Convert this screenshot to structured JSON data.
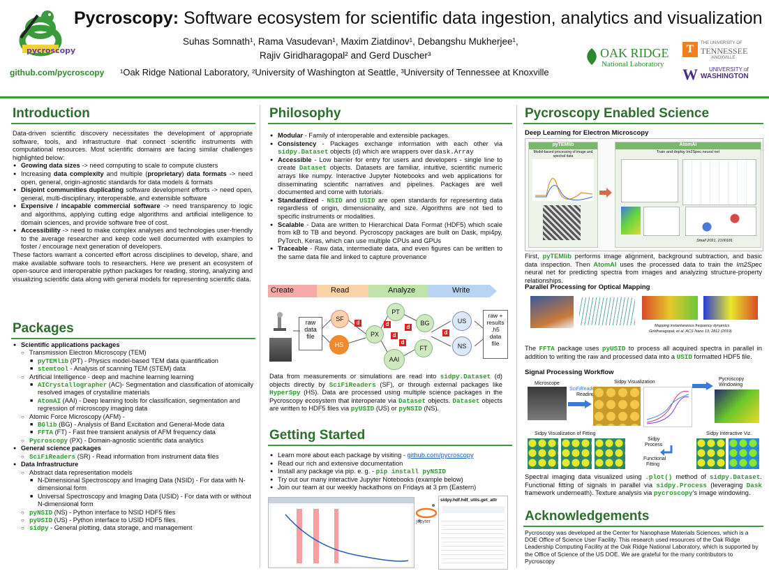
{
  "header": {
    "title_bold": "Pycroscopy:",
    "title_rest": " Software ecosystem for scientific data ingestion, analytics and visualization",
    "authors_line1": "Suhas Somnath¹, Rama Vasudevan¹, Maxim Ziatdinov¹, Debangshu Mukherjee¹,",
    "authors_line2": "Rajiv Giridharagopal² and Gerd Duscher³",
    "affiliations": "¹Oak Ridge National Laboratory, ²University of Washington at Seattle, ³University of Tennessee at Knoxville",
    "logo_text": "pycroscopy",
    "github": "github.com/pycroscopy",
    "ornl_line1": "OAK RIDGE",
    "ornl_line2": "National Laboratory",
    "utk_line1": "THE UNIVERSITY OF",
    "utk_line2": "TENNESSEE",
    "utk_line3": "KNOXVILLE",
    "uw_line1": "UNIVERSITY of",
    "uw_line2": "WASHINGTON",
    "colors": {
      "green": "#2c6e2c",
      "orange": "#f07f1e",
      "purple": "#4b2e83"
    }
  },
  "intro": {
    "title": "Introduction",
    "para1": "Data-driven scientific discovery necessitates the development of appropriate software, tools, and infrastructure that connect scientific instruments with computational resources. Most scientific domains are facing similar challenges highlighted below:",
    "bullets": [
      {
        "b": "Growing data sizes",
        "t": " -> need computing to scale to compute clusters"
      },
      {
        "b": "",
        "t": "Increasing data complexity and multiple (proprietary) data formats -> need open, general, origin-agnostic standards for data models & formats"
      },
      {
        "b": "Disjoint communities duplicating",
        "t": " software development efforts -> need open, general, multi-disciplinary, interoperable, and extensible software"
      },
      {
        "b": "Expensive / incapable commercial software",
        "t": " -> need transparency to logic and algorithms, applying cutting edge algorithms and artificial intelligence to domain sciences, and provide software free of cost."
      },
      {
        "b": "Accessibility",
        "t": " -> need to make complex analyses and technologies user-friendly to the average researcher and keep code well documented with examples to foster / encourage next generation of developers."
      }
    ],
    "para2": "These factors warrant a concerted effort across disciplines to develop, share, and make available software tools to researchers. Here we present an ecosystem of open-source and interoperable python packages for reading, storing, analyzing and visualizing scientific data along with general models for representing scientific data."
  },
  "packages": {
    "title": "Packages",
    "sci_apps": "Scientific applications packages",
    "tem": "Transmission Electron Microscopy (TEM)",
    "pytemlib": "pyTEMlib",
    "pytemlib_desc": " (PT) - Physics model-based TEM data quantification",
    "stemtool": "stemtool",
    "stemtool_desc": " - Analysis of scanning TEM (STEM) data",
    "ai": "Artificial Intelligence - deep and machine learning learning",
    "aicryst": "AICrystallographer",
    "aicryst_desc": " (AC)- Segmentation and classification of atomically resolved images of crystalline materials",
    "atomai": "AtomAI",
    "atomai_desc": " (AAI) - Deep learning tools for classification, segmentation and regression of microscopy imaging data",
    "afm": "Atomic Force Microscopy (AFM) -",
    "bglib": "BGlib",
    "bglib_desc": " (BG) - Analysis of Band Excitation and General-Mode data",
    "ffta": "FFTA",
    "ffta_desc": " (FT) - Fast free transient analysis of AFM frequency data",
    "pycro": "Pycroscopy",
    "pycro_desc": " (PX) - Domain-agnostic scientific data analytics",
    "gen_sci": "General science packages",
    "scifi": "SciFiReaders",
    "scifi_desc": " (SR) - Read information from instrument data files",
    "infra": "Data Infrastructure",
    "abstract": "Abstract data representation models",
    "nsid": "N-Dimensional Spectroscopy and Imaging Data (NSID) - For data with N-dimensional form",
    "usid": "Universal Spectroscopy and Imaging Data (USID) - For data with or without N-dimensional form",
    "pynsid": "pyNSID",
    "pynsid_desc": " (NS) - Python interface to NSID HDF5 files",
    "pyusid": "pyUSID",
    "pyusid_desc": " (US) - Python interface to USID HDF5 files",
    "sidpy": "sidpy",
    "sidpy_desc": " - General plotting, data storage, and management"
  },
  "philosophy": {
    "title": "Philosophy",
    "items": [
      {
        "b": "Modular",
        "t": " - Family of interoperable and extensible packages."
      },
      {
        "b": "Consistency",
        "t": " - Packages exchange information with each other via sidpy.Dataset objects (d) which are wrappers over dask.Array"
      },
      {
        "b": "Accessible",
        "t": " - Low barrier for entry for users and developers - single line to create Dataset objects. Datasets are familiar, intuitive, scientific numeric arrays like numpy. Interactive Jupyter Notebooks and web applications for disseminating scientific narratives and pipelines. Packages are well documented and come with tutorials."
      },
      {
        "b": "Standardized",
        "t": " - NSID and USID are open standards for representing data regardless of origin, dimensionality, and size. Algorithms are not tied to specific instruments or modalities."
      },
      {
        "b": "Scalable",
        "t": " - Data are written to Hierarchical Data Format (HDF5) which scale from kB to TB and beyond. Pycroscopy packages are built on Dask, mpi4py, PyTorch, Keras, which can use multiple CPUs and GPUs"
      },
      {
        "b": "Traceable",
        "t": " - Raw data, intermediate data, and even figures can be written to the same data file and linked to capture provenance"
      }
    ],
    "flow": {
      "create": "Create",
      "read": "Read",
      "analyze": "Analyze",
      "write": "Write"
    },
    "nodes": {
      "raw": "raw\ndata\nfile",
      "sf": "SF",
      "hs": "HS",
      "pt": "PT",
      "px": "PX",
      "bg": "BG",
      "ft": "FT",
      "aai": "AAI",
      "us": "US",
      "ns": "NS",
      "out": "raw +\nresults\n.h5\ndata\nfile",
      "d": "d"
    },
    "caption": "Data from measurements or simulations are read into sidpy.Dataset (d) objects directly by SciFiReaders (SF), or through external packages like HyperSpy (HS). Data are processed using multiple science packages in the Pycroscopy ecosystem that interoperate via Dataset objects. Dataset objects are written to HDF5 files via pyUSID (US) or pyNSID (NS)."
  },
  "getting_started": {
    "title": "Getting Started",
    "items": [
      {
        "t": "Learn more about each package by visiting - ",
        "link": "github.com/pycroscopy"
      },
      {
        "t": "Read our rich and extensive documentation",
        "link": ""
      },
      {
        "t": "Install any package via pip. e. g. - ",
        "code": "pip install pyNSID"
      },
      {
        "t": "Try out our many interactive Jupyter Notebooks (example below)",
        "link": ""
      },
      {
        "t": "Join our team at our weekly hackathons on Fridays at 3 pm (Eastern)",
        "link": ""
      }
    ],
    "nb_title": "sidpy.hdf.hdf_utils.get_attr",
    "jupyter": "jupyter"
  },
  "enabled": {
    "title": "Pycroscopy Enabled Science",
    "dl_head": "Deep Learning for Electron Microscopy",
    "dl_fig_left": "pyTEMlib",
    "dl_fig_left_sub": "Model-based processing of image and spectral data",
    "dl_fig_right": "AtomAI",
    "dl_fig_right_sub": "Train and deploy Im2Spec neural net",
    "dl_ref": "Small 2021, 2100181",
    "dl_caption": "First, pyTEMlib performs image alignment, background subtraction, and basic data inspection. Then AtomAI uses the processed data to train the Im2Spec neural net for predicting spectra from images and analyzing structure-property relationships.",
    "pp_head": "Parallel Processing for Optical Mapping",
    "pp_ref1": "Mapping instantaneous frequency dynamics",
    "pp_ref2": "Giridharagopal, et al. ACS Nano 13, 2812 (2019)",
    "pp_caption": "The FFTA package uses pyUSID to process all acquired spectra in parallel in addition to writing the raw and processed data into a USID formatted HDF5 file.",
    "sp_head": "Signal Processing Workflow",
    "sp_labels": {
      "microscope": "Microscope",
      "scifi": "SciFiReaders",
      "reading": "Reading",
      "sidpy_vis": "Sidpy Visualization",
      "pycro": "Pycroscopy",
      "windowing": "Windowing",
      "fit_vis": "Sidpy Visualization of Fitting",
      "sidpy_proc1": "Sidpy",
      "sidpy_proc2": "Process",
      "func_fit1": "Functional",
      "func_fit2": "Fitting",
      "inter": "Sidpy Interactive Viz."
    },
    "sp_caption": "Spectral imaging data visualized using .plot() method of sidpy.Dataset. Functional fitting of signals in parallel via sidpy.Process (leveraging Dask framework underneath). Texture analysis via pycroscopy's image windowing."
  },
  "ack": {
    "title": "Acknowledgements",
    "text": "Pycroscopy was developed at the Center for Nanophase Materials Sciences, which is a DOE Office of Science User Facility. This research used resources of the Oak Ridge Leadership Computing Facility at the Oak Ridge National Laboratory, which is supported by the Office of Science of the US DOE. We are grateful for the many contributors to Pycroscopy"
  }
}
